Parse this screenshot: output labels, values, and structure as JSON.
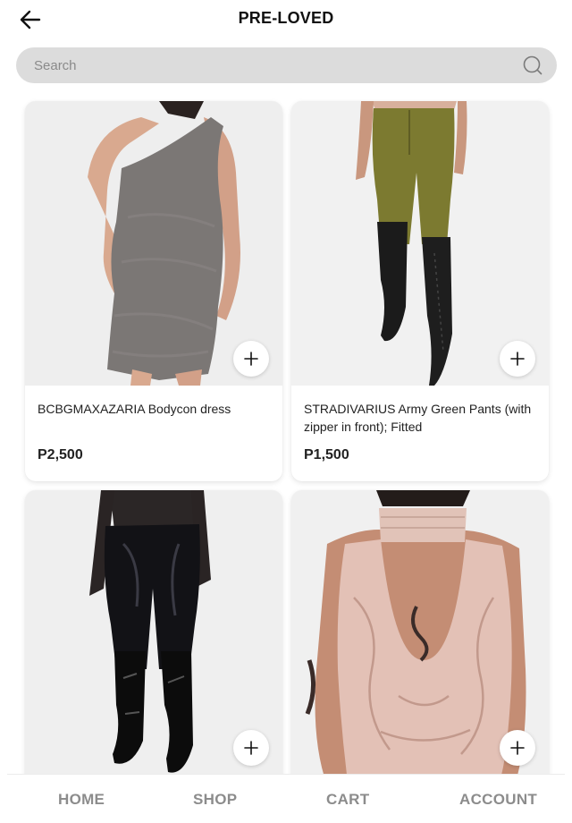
{
  "header": {
    "title": "PRE-LOVED",
    "back_icon": "arrow-left-icon"
  },
  "search": {
    "placeholder": "Search",
    "value": "",
    "icon": "search-icon"
  },
  "products": [
    {
      "name": "BCBGMAXAZARIA Bodycon dress",
      "price": "P2,500"
    },
    {
      "name": "STRADIVARIUS Army Green Pants (with zipper in front); Fitted",
      "price": "P1,500"
    },
    {
      "name": "",
      "price": ""
    },
    {
      "name": "",
      "price": ""
    }
  ],
  "add_icon": "plus-icon",
  "nav": {
    "home": "HOME",
    "shop": "SHOP",
    "cart": "CART",
    "account": "ACCOUNT"
  },
  "colors": {
    "search_bg": "#dcdcdc",
    "nav_text": "#8c8c8c",
    "text": "#222222"
  }
}
